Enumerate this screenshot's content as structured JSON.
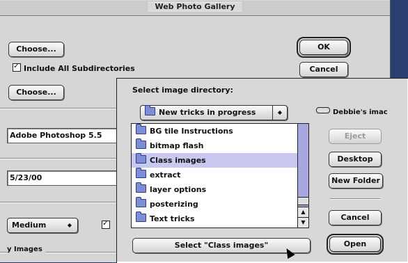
{
  "back_dialog": {
    "title": "Web Photo Gallery",
    "choose_label_1": "Choose...",
    "include_subdirs_label": "Include All Subdirectories",
    "choose_label_2": "Choose...",
    "ok_label": "OK",
    "cancel_label": "Cancel",
    "generator_value": "Adobe Photoshop 5.5",
    "date_value": "5/23/00",
    "size_value": "Medium",
    "images_label": "y Images"
  },
  "chooser": {
    "prompt": "Select image directory:",
    "folder_popup": "New tricks in progress",
    "disk_name": "Debbie's imac",
    "items": [
      {
        "label": "BG tile Instructions"
      },
      {
        "label": "bitmap flash"
      },
      {
        "label": "Class images"
      },
      {
        "label": "extract"
      },
      {
        "label": "layer options"
      },
      {
        "label": "posterizing"
      },
      {
        "label": "Text tricks"
      }
    ],
    "eject_label": "Eject",
    "desktop_label": "Desktop",
    "new_folder_label": "New Folder",
    "cancel_label": "Cancel",
    "open_label": "Open",
    "select_label": "Select \"Class images\""
  }
}
